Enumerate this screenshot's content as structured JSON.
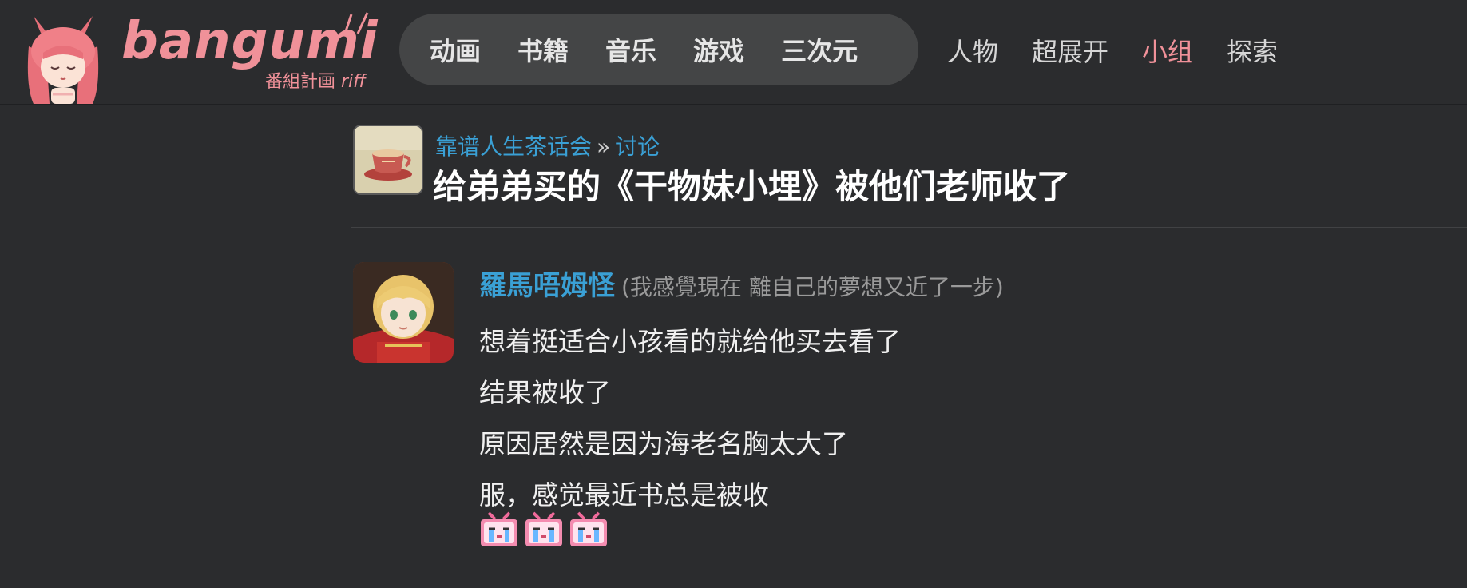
{
  "logo": {
    "text": "bangumi",
    "subtitle": "番組計画",
    "subtitle_suffix": "riff",
    "color": "#f09199"
  },
  "nav": {
    "primary": [
      "动画",
      "书籍",
      "音乐",
      "游戏",
      "三次元"
    ],
    "secondary": [
      {
        "label": "人物",
        "active": false
      },
      {
        "label": "超展开",
        "active": false
      },
      {
        "label": "小组",
        "active": true
      },
      {
        "label": "探索",
        "active": false
      }
    ]
  },
  "topic": {
    "group_name": "靠谱人生茶话会",
    "separator": "»",
    "section": "讨论",
    "title": "给弟弟买的《干物妹小埋》被他们老师收了"
  },
  "post": {
    "username": "羅馬唔姆怪",
    "signature": "(我感覺現在 離自己的夢想又近了一步)",
    "lines": [
      "想着挺适合小孩看的就给他买去看了",
      "结果被收了",
      "原因居然是因为海老名胸太大了",
      "服，感觉最近书总是被收"
    ],
    "stickers": [
      "crying-tv-sticker",
      "crying-tv-sticker",
      "crying-tv-sticker"
    ]
  },
  "colors": {
    "background": "#2b2c2e",
    "link": "#3aa0d5",
    "accent": "#f09199",
    "pill": "#444546"
  }
}
